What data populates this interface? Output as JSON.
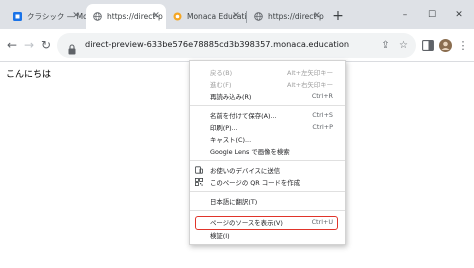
{
  "tabs": [
    {
      "title": "クラシック — Mo",
      "favicon": "monaca-classic-icon"
    },
    {
      "title": "https://direct-p",
      "favicon": "globe-icon"
    },
    {
      "title": "Monaca Education",
      "favicon": "monaca-education-icon"
    },
    {
      "title": "https://direct-p",
      "favicon": "globe-icon"
    }
  ],
  "new_tab_label": "+",
  "window": {
    "minimize": "–",
    "maximize": "☐",
    "close": "✕"
  },
  "address_bar": {
    "url": "direct-preview-633be576e78885cd3b398357.monaca.education"
  },
  "page": {
    "greeting": "こんにちは"
  },
  "context_menu": {
    "items": [
      {
        "label": "戻る(B)",
        "shortcut": "Alt+左矢印キー",
        "disabled": true
      },
      {
        "label": "進む(F)",
        "shortcut": "Alt+右矢印キー",
        "disabled": true
      },
      {
        "label": "再読み込み(R)",
        "shortcut": "Ctrl+R",
        "disabled": false
      },
      {
        "label": "名前を付けて保存(A)...",
        "shortcut": "Ctrl+S",
        "disabled": false
      },
      {
        "label": "印刷(P)...",
        "shortcut": "Ctrl+P",
        "disabled": false
      },
      {
        "label": "キャスト(C)...",
        "shortcut": "",
        "disabled": false
      },
      {
        "label": "Google Lens で画像を検索",
        "shortcut": "",
        "disabled": false
      },
      {
        "label": "お使いのデバイスに送信",
        "shortcut": "",
        "disabled": false,
        "icon": "devices-icon"
      },
      {
        "label": "このページの QR コードを作成",
        "shortcut": "",
        "disabled": false,
        "icon": "qr-code-icon"
      },
      {
        "label": "日本語に翻訳(T)",
        "shortcut": "",
        "disabled": false
      },
      {
        "label": "ページのソースを表示(V)",
        "shortcut": "Ctrl+U",
        "disabled": false
      },
      {
        "label": "検証(I)",
        "shortcut": "",
        "disabled": false
      }
    ]
  },
  "colors": {
    "highlight": "#e0342a",
    "tabbar": "#dee1e6",
    "monaca_blue": "#1a73e8",
    "monaca_orange": "#f5a623"
  }
}
